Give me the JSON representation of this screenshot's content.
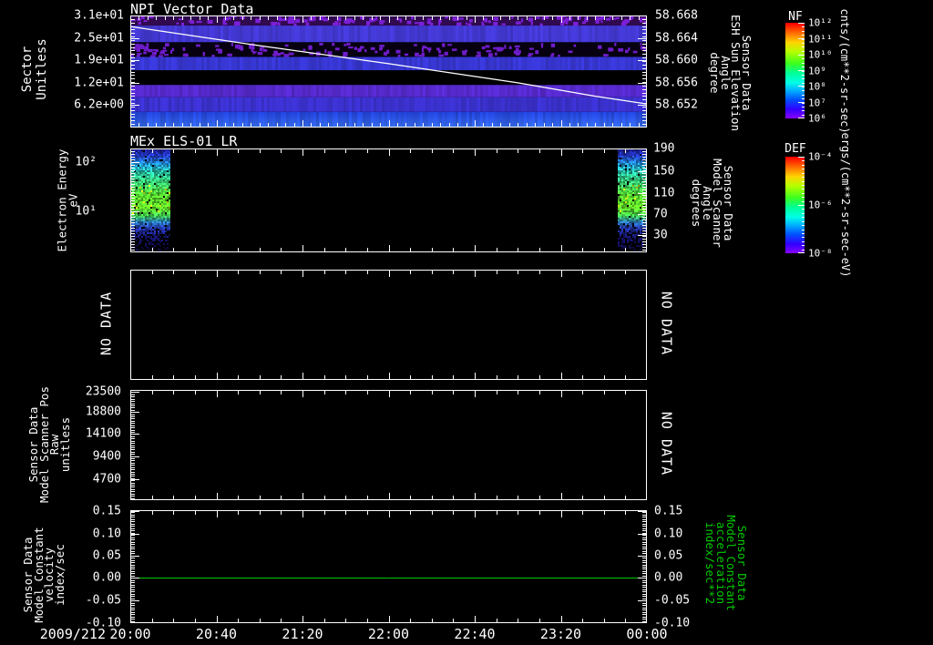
{
  "app": {
    "description": "Multi-panel orbit/time series spectrogram display"
  },
  "colors": {
    "background": "#000000",
    "axis": "#ffffff",
    "text": "#ffffff",
    "accent_green": "#00cc00",
    "overlay_line": "#ffffff",
    "rainbow_scale": [
      [
        0,
        "#ff0000"
      ],
      [
        0.1,
        "#ff6a00"
      ],
      [
        0.2,
        "#ffd400"
      ],
      [
        0.3,
        "#b4ff00"
      ],
      [
        0.42,
        "#3cff1e"
      ],
      [
        0.52,
        "#00ff96"
      ],
      [
        0.62,
        "#00ffe6"
      ],
      [
        0.7,
        "#00b4ff"
      ],
      [
        0.8,
        "#0050ff"
      ],
      [
        0.9,
        "#3200ff"
      ],
      [
        1,
        "#8c00ff"
      ]
    ]
  },
  "x_axis": {
    "date_label": "2009/212",
    "tick_labels": [
      "20:00",
      "20:40",
      "21:20",
      "22:00",
      "22:40",
      "23:20",
      "00:00"
    ]
  },
  "panels": {
    "p1": {
      "title": "NPI Vector Data",
      "ylabel_left": [
        "Sector",
        "Unitless"
      ],
      "left_ticks": [
        "3.1e+01",
        "2.5e+01",
        "1.9e+01",
        "1.2e+01",
        "6.2e+00"
      ],
      "ylabel_right": [
        "Sensor Data",
        "ESH Sun Elevation",
        "Angle",
        "degree"
      ],
      "right_ticks": [
        "58.668",
        "58.664",
        "58.660",
        "58.656",
        "58.652"
      ]
    },
    "p2": {
      "title": "MEx ELS-01 LR",
      "ylabel_left": [
        "Electron Energy",
        "eV"
      ],
      "left_ticks": [
        "10²",
        "10¹"
      ],
      "ylabel_right": [
        "Sensor Data",
        "Model Scanner",
        "Angle",
        "degrees"
      ],
      "right_ticks": [
        "190",
        "150",
        "110",
        "70",
        "30"
      ]
    },
    "p3": {
      "no_data_left": "NO DATA",
      "no_data_right": "NO DATA"
    },
    "p4": {
      "ylabel_left": [
        "Sensor Data",
        "Model Scanner Pos",
        "Raw",
        "unitless"
      ],
      "left_ticks": [
        "23500",
        "18800",
        "14100",
        "9400",
        "4700"
      ],
      "no_data_right": "NO DATA"
    },
    "p5": {
      "ylabel_left": [
        "Sensor Data",
        "Model Constant",
        "velocity",
        "index/sec"
      ],
      "left_ticks": [
        "0.15",
        "0.10",
        "0.05",
        "0.00",
        "-0.05",
        "-0.10"
      ],
      "ylabel_right": [
        "Sensor Data",
        "Model Constant",
        "acceleration",
        "index/sec**2"
      ],
      "right_ticks": [
        "0.15",
        "0.10",
        "0.05",
        "0.00",
        "-0.05",
        "-0.10"
      ]
    }
  },
  "colorbars": {
    "nf": {
      "title": "NF",
      "ticks": [
        "10¹²",
        "10¹¹",
        "10¹⁰",
        "10⁹",
        "10⁸",
        "10⁷",
        "10⁶"
      ],
      "units": "cnts/(cm**2-sr-sec)"
    },
    "def": {
      "title": "DEF",
      "ticks": [
        "10⁻⁴",
        "10⁻⁶",
        "10⁻⁸"
      ],
      "units": "ergs/(cm**2-sr-sec-eV)"
    }
  },
  "chart_data": [
    {
      "id": "p1",
      "type": "heatmap",
      "title": "NPI Vector Data",
      "x_range": [
        "2009/212 20:00",
        "00:00"
      ],
      "ylabel": "Sector (Unitless)",
      "y_ticks": [
        31,
        25,
        19,
        12,
        6.2
      ],
      "ylim": [
        0,
        32
      ],
      "right_axis": {
        "label": "Sensor Data ESH Sun Elevation Angle (degree)",
        "ticks": [
          58.668,
          58.664,
          58.66,
          58.656,
          58.652
        ]
      },
      "colorbar": "NF",
      "colorbar_range_log10": [
        6,
        12
      ],
      "bands": [
        {
          "y0": 0.0,
          "y1": 0.09,
          "color": "#30094f",
          "speckle": {
            "color": "#7d1fd6",
            "density": 0.5
          }
        },
        {
          "y0": 0.09,
          "y1": 0.24,
          "color": "#4a3ee8",
          "texture": true
        },
        {
          "y0": 0.24,
          "y1": 0.37,
          "color": "#060010",
          "speckle": {
            "color": "#6e1cc8",
            "density": 0.38
          }
        },
        {
          "y0": 0.37,
          "y1": 0.49,
          "color": "#3d3ce6",
          "texture": true
        },
        {
          "y0": 0.49,
          "y1": 0.62,
          "color": "#000000"
        },
        {
          "y0": 0.62,
          "y1": 0.73,
          "color": "#5e2ee0",
          "texture": true
        },
        {
          "y0": 0.73,
          "y1": 0.86,
          "color": "#4136e2",
          "texture": true
        },
        {
          "y0": 0.86,
          "y1": 1.0,
          "color": "#2547f0",
          "color2": "#3b76ff",
          "texture": true
        }
      ],
      "overlay_line": {
        "name": "ESH Sun Elevation Angle",
        "color": "#ffffff",
        "value_start": 58.666,
        "value_end": 58.652,
        "points": [
          [
            0,
            0.098
          ],
          [
            0.25,
            0.27
          ],
          [
            0.5,
            0.43
          ],
          [
            0.75,
            0.6
          ],
          [
            0.9,
            0.72
          ],
          [
            1,
            0.79
          ]
        ]
      }
    },
    {
      "id": "p2",
      "type": "heatmap",
      "title": "MEx ELS-01 LR",
      "ylabel": "Electron Energy (eV)",
      "y_scale": "log",
      "y_ticks": [
        100,
        10
      ],
      "right_axis": {
        "label": "Sensor Data Model Scanner Angle (degrees)",
        "ticks": [
          190,
          150,
          110,
          70,
          30
        ]
      },
      "colorbar": "DEF",
      "colorbar_range_log10": [
        -8,
        -4
      ],
      "data_intervals_x": [
        [
          0.0,
          0.075
        ],
        [
          0.944,
          1.0
        ]
      ],
      "note": "electron flux present only near 20:00-20:18 and 23:47-00:00, peak ~10-40 eV",
      "profile": [
        [
          0,
          "#1a1a80"
        ],
        [
          0.06,
          "#2438c8"
        ],
        [
          0.14,
          "#2090d8"
        ],
        [
          0.22,
          "#28c0a0"
        ],
        [
          0.32,
          "#38cc70"
        ],
        [
          0.44,
          "#55dc30"
        ],
        [
          0.56,
          "#62e026"
        ],
        [
          0.64,
          "#3cc04a"
        ],
        [
          0.7,
          "#2878b8"
        ],
        [
          0.76,
          "#2334a8"
        ],
        [
          0.85,
          "#141265"
        ],
        [
          1,
          "#0a0838"
        ]
      ]
    },
    {
      "id": "p3",
      "type": "empty",
      "status": "NO DATA"
    },
    {
      "id": "p4",
      "type": "empty",
      "status": "NO DATA",
      "ylabel": "Sensor Data Model Scanner Pos Raw (unitless)",
      "y_ticks": [
        23500,
        18800,
        14100,
        9400,
        4700
      ]
    },
    {
      "id": "p5",
      "type": "line",
      "ylabel": "Sensor Data Model Constant velocity (index/sec)",
      "right_label": "Sensor Data Model Constant acceleration (index/sec**2)",
      "y_ticks": [
        0.15,
        0.1,
        0.05,
        0.0,
        -0.05,
        -0.1
      ],
      "ylim": [
        -0.1,
        0.15
      ],
      "series": [
        {
          "name": "velocity",
          "color": "#00c800",
          "constant_value": 0.0
        }
      ]
    }
  ]
}
